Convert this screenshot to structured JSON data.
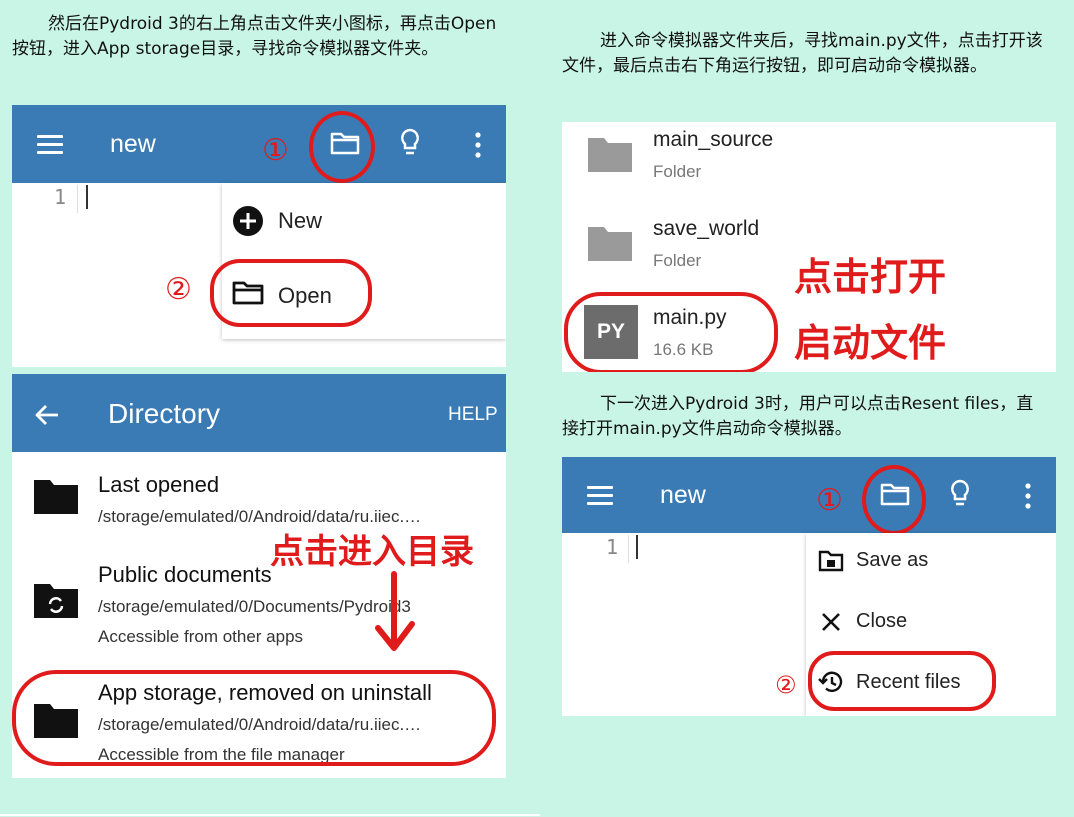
{
  "left_intro": "然后在Pydroid 3的右上角点击文件夹小图标，再点击Open按钮，进入App storage目录，寻找命令模拟器文件夹。",
  "right_intro": "进入命令模拟器文件夹后，寻找main.py文件，点击打开该文件，最后点击右下角运行按钮，即可启动命令模拟器。",
  "right_middle": "下一次进入Pydroid 3时，用户可以点击Resent files，直接打开main.py文件启动命令模拟器。",
  "colors": {
    "appbar": "#3a7bb5",
    "annotation_red": "#e01b1b",
    "background": "#c9f5e6"
  },
  "editor1": {
    "title": "new",
    "line_number": "1",
    "step1": "①",
    "step2": "②",
    "menu": {
      "new_label": "New",
      "open_label": "Open"
    },
    "icons": [
      "menu-icon",
      "folder-icon",
      "lightbulb-icon",
      "more-vert-icon",
      "add-circle-icon",
      "folder-outline-icon"
    ]
  },
  "directory": {
    "title": "Directory",
    "help": "HELP",
    "annotation": "点击进入目录",
    "items": [
      {
        "title": "Last opened",
        "path": "/storage/emulated/0/Android/data/ru.iiec.…",
        "desc": ""
      },
      {
        "title": "Public documents",
        "path": "/storage/emulated/0/Documents/Pydroid3",
        "desc": "Accessible from other apps"
      },
      {
        "title": "App storage, removed on uninstall",
        "path": "/storage/emulated/0/Android/data/ru.iiec.…",
        "desc": "Accessible from the file manager"
      }
    ]
  },
  "files": {
    "annotation_line1": "点击打开",
    "annotation_line2": "启动文件",
    "items": [
      {
        "name": "main_source",
        "sub": "Folder"
      },
      {
        "name": "save_world",
        "sub": "Folder"
      },
      {
        "name": "main.py",
        "sub": "16.6 KB",
        "badge": "PY"
      }
    ]
  },
  "editor2": {
    "title": "new",
    "line_number": "1",
    "step1": "①",
    "step2": "②",
    "menu": {
      "save_as_label": "Save as",
      "close_label": "Close",
      "recent_label": "Recent files"
    }
  }
}
